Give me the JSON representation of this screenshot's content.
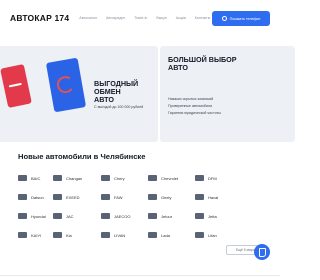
{
  "header": {
    "logo": "АВТОКАР 174",
    "nav": [
      "Автосалон",
      "Автокредит",
      "Trade-in",
      "Выкуп",
      "Акции",
      "Контакты"
    ],
    "cta_label": "Показать телефон"
  },
  "banners": [
    {
      "title_line1": "ВЫГОДНЫЙ ОБМЕН",
      "title_line2": "АВТО",
      "text": "С выгодой до 100 000 рублей"
    },
    {
      "title_line1": "БОЛЬШОЙ ВЫБОР",
      "title_line2": "АВТО",
      "bullets": [
        "Никаких скрытых комиссий",
        "Проверенные автомобили",
        "Гарантия юридической чистоты"
      ]
    }
  ],
  "section": {
    "title": "Новые автомобили в Челябинске",
    "brands": [
      [
        "BAIC",
        "Changan",
        "Chery",
        "Chevrolet",
        "DFM"
      ],
      [
        "Datsun",
        "EXEED",
        "FAW",
        "Geely",
        "Haval"
      ],
      [
        "Hyundai",
        "JAC",
        "JAECOO",
        "Jetour",
        "Jetta"
      ],
      [
        "KAIYI",
        "Kia",
        "LIVAN",
        "Lada",
        "Lifan"
      ]
    ],
    "more_label": "Ещё 5 марок"
  },
  "colors": {
    "accent": "#2f6df0",
    "banner_bg": "#edf1f6"
  }
}
